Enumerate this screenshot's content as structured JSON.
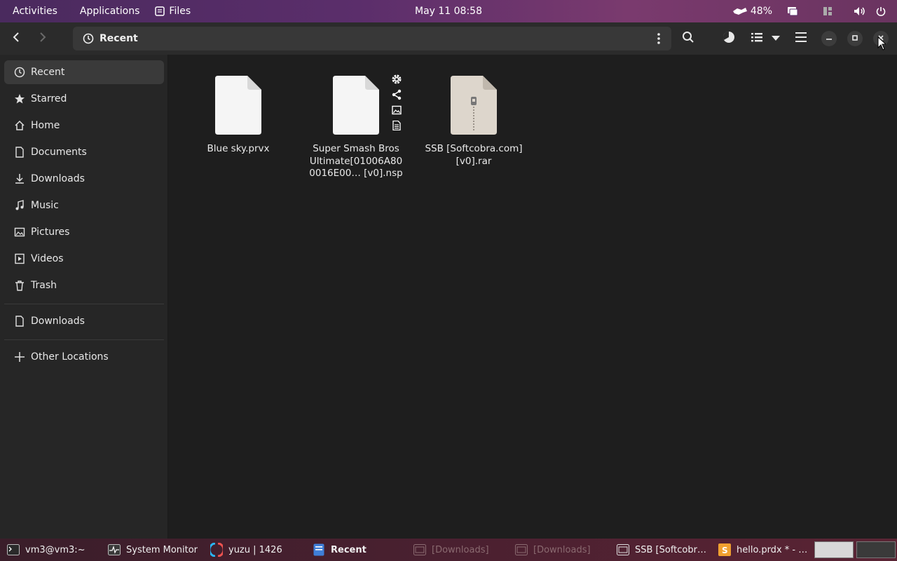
{
  "topbar": {
    "activities": "Activities",
    "applications": "Applications",
    "files_app": "Files",
    "clock": "May 11  08:58",
    "battery_pct": "48%"
  },
  "header": {
    "location": "Recent"
  },
  "sidebar": {
    "items": [
      {
        "label": "Recent",
        "icon": "clock-icon"
      },
      {
        "label": "Starred",
        "icon": "star-icon"
      },
      {
        "label": "Home",
        "icon": "home-icon"
      },
      {
        "label": "Documents",
        "icon": "document-icon"
      },
      {
        "label": "Downloads",
        "icon": "download-icon"
      },
      {
        "label": "Music",
        "icon": "music-icon"
      },
      {
        "label": "Pictures",
        "icon": "picture-icon"
      },
      {
        "label": "Videos",
        "icon": "video-icon"
      },
      {
        "label": "Trash",
        "icon": "trash-icon"
      }
    ],
    "bookmarks": [
      {
        "label": "Downloads",
        "icon": "folder-icon"
      }
    ],
    "other_locations": "Other Locations"
  },
  "files": [
    {
      "name": "Blue sky.prvx",
      "icon": "blank-file-icon"
    },
    {
      "name": "Super Smash Bros Ultimate[01006A80 0016E00… [v0].nsp",
      "icon": "blank-file-icon"
    },
    {
      "name": "SSB [Softcobra.com] [v0].rar",
      "icon": "archive-file-icon"
    }
  ],
  "taskbar": {
    "tasks": [
      {
        "label": "vm3@vm3:~",
        "icon": "terminal-icon"
      },
      {
        "label": "System Monitor",
        "icon": "system-monitor-icon"
      },
      {
        "label": "yuzu | 1426",
        "icon": "yuzu-icon"
      },
      {
        "label": "Recent",
        "icon": "files-icon"
      },
      {
        "label": "[Downloads]",
        "icon": "files-icon"
      },
      {
        "label": "[Downloads]",
        "icon": "files-icon"
      },
      {
        "label": "SSB [Softcobr…",
        "icon": "files-icon"
      },
      {
        "label": "hello.prdx * - …",
        "icon": "editor-icon"
      }
    ]
  },
  "colors": {
    "topbar_start": "#4a2a5e",
    "sidebar_bg": "#262626",
    "main_bg": "#1e1e1e",
    "active_item": "#3a3a3a"
  }
}
